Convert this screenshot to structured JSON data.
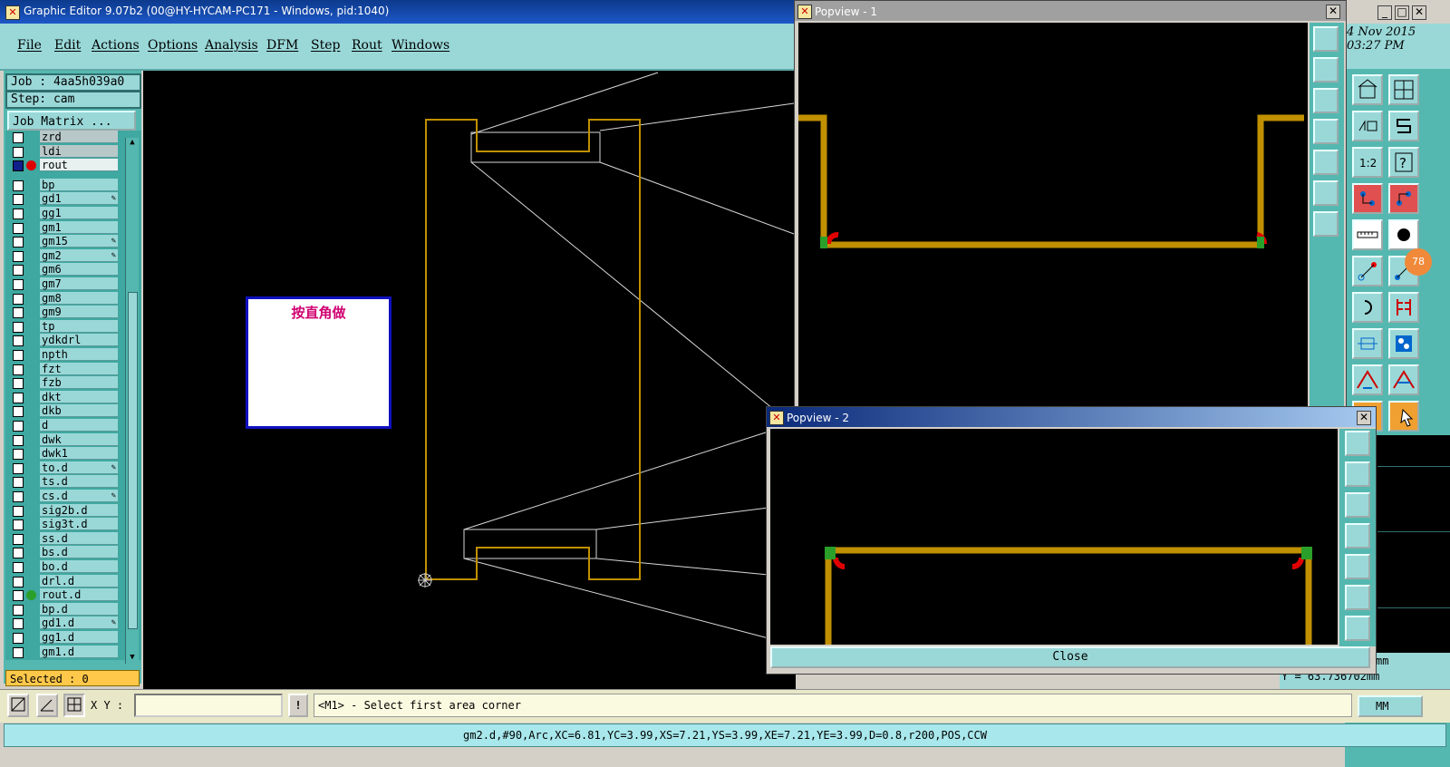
{
  "app": {
    "title": "Graphic Editor 9.07b2 (00@HY-HYCAM-PC171 - Windows, pid:1040)"
  },
  "menu": [
    "File",
    "Edit",
    "Actions",
    "Options",
    "Analysis",
    "DFM",
    "Step",
    "Rout",
    "Windows"
  ],
  "job": {
    "label": "Job : 4aa5h039a0",
    "step": "Step: cam",
    "matrix_button": "Job Matrix ..."
  },
  "layers": [
    {
      "name": "zrd",
      "shaded": true
    },
    {
      "name": "ldi",
      "shaded": true
    },
    {
      "name": "rout",
      "active": true,
      "dot": "#e00000"
    },
    {
      "name": "bp"
    },
    {
      "name": "gd1",
      "mark": "✎"
    },
    {
      "name": "gg1"
    },
    {
      "name": "gm1"
    },
    {
      "name": "gm15",
      "mark": "✎"
    },
    {
      "name": "gm2",
      "mark": "✎"
    },
    {
      "name": "gm6"
    },
    {
      "name": "gm7"
    },
    {
      "name": "gm8"
    },
    {
      "name": "gm9"
    },
    {
      "name": "tp"
    },
    {
      "name": "ydkdrl"
    },
    {
      "name": "npth"
    },
    {
      "name": "fzt"
    },
    {
      "name": "fzb"
    },
    {
      "name": "dkt"
    },
    {
      "name": "dkb"
    },
    {
      "name": "d"
    },
    {
      "name": "dwk"
    },
    {
      "name": "dwk1"
    },
    {
      "name": "to.d",
      "mark": "✎"
    },
    {
      "name": "ts.d"
    },
    {
      "name": "cs.d",
      "mark": "✎"
    },
    {
      "name": "sig2b.d"
    },
    {
      "name": "sig3t.d"
    },
    {
      "name": "ss.d"
    },
    {
      "name": "bs.d"
    },
    {
      "name": "bo.d"
    },
    {
      "name": "drl.d"
    },
    {
      "name": "rout.d",
      "dot": "#2aa02a"
    },
    {
      "name": "bp.d"
    },
    {
      "name": "gd1.d",
      "mark": "✎"
    },
    {
      "name": "gg1.d"
    },
    {
      "name": "gm1.d"
    }
  ],
  "selected": "Selected : 0",
  "note_box": "按直角做",
  "popview1": {
    "title": "Popview - 1"
  },
  "popview2": {
    "title": "Popview - 2",
    "close": "Close"
  },
  "datetime": {
    "date": "4 Nov 2015",
    "time": "03:27 PM"
  },
  "right_badge": "78",
  "coords": {
    "mm_fragment": "mm",
    "y_readout": "Y = 63.736702mm"
  },
  "bottom": {
    "xy_label": "X Y :",
    "xy_value": "",
    "message": "<M1> - Select first area corner",
    "units": "MM"
  },
  "status": "gm2.d,#90,Arc,XC=6.81,YC=3.99,XS=7.21,YS=3.99,XE=7.21,YE=3.99,D=0.8,r200,POS,CCW",
  "colors": {
    "trace": "#c09000",
    "red_arc": "#e00000",
    "green": "#2aa02a",
    "canvas": "#000000",
    "panel": "#9ad8d8"
  }
}
